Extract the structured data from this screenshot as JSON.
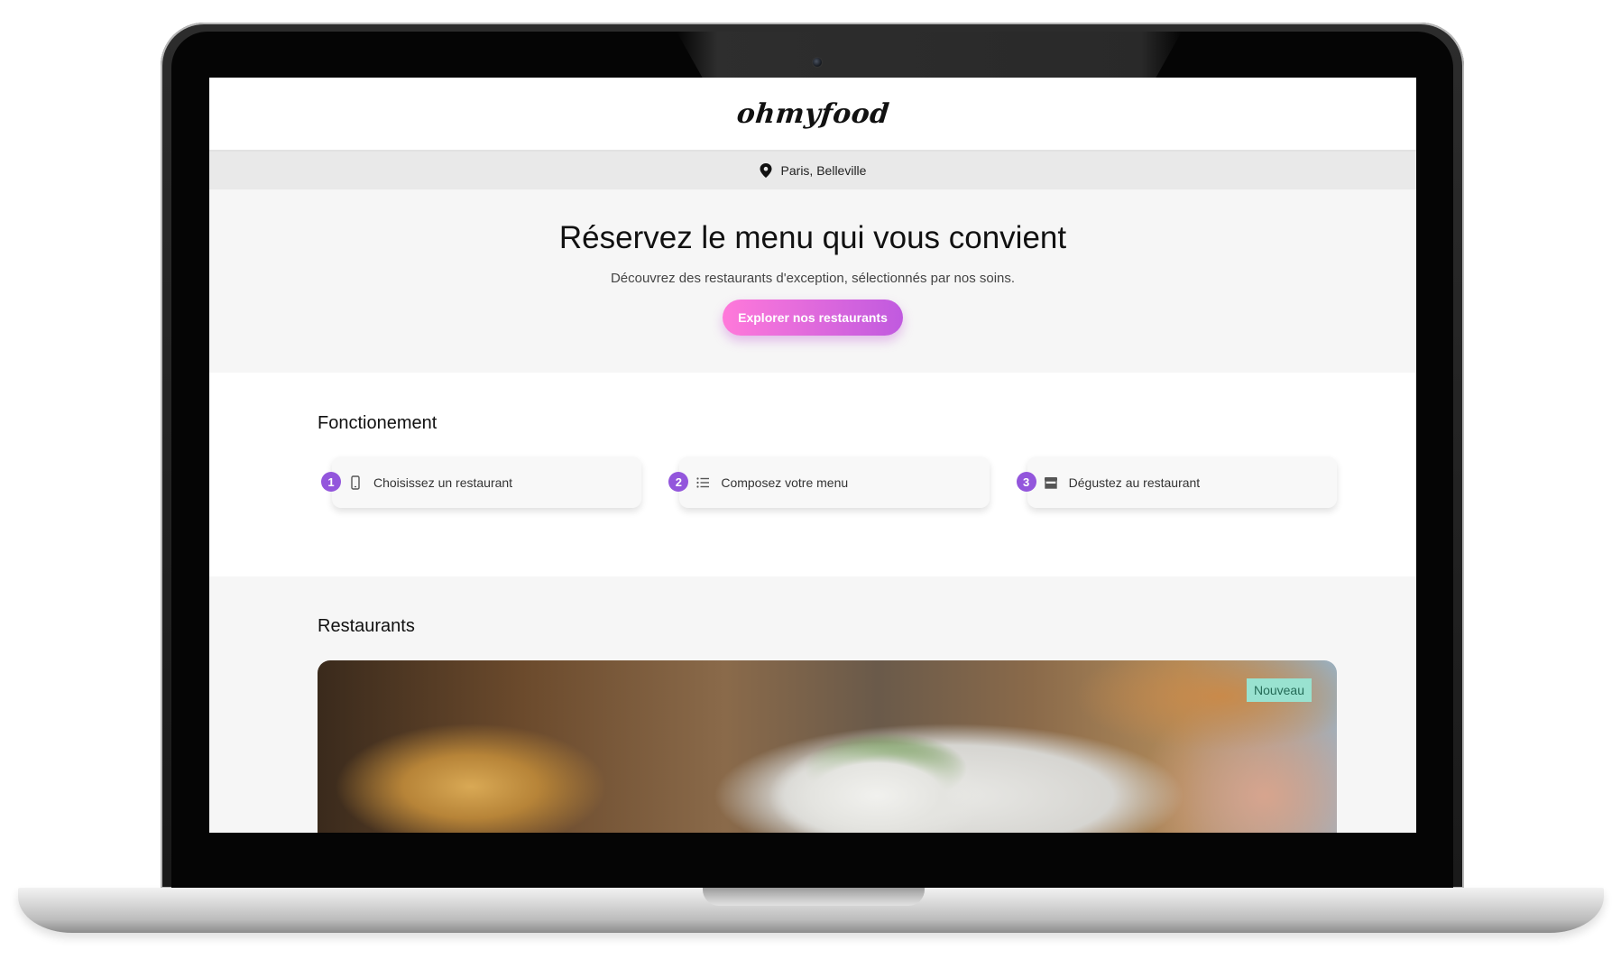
{
  "header": {
    "logo": "ohmyfood"
  },
  "location": {
    "icon": "map-pin-icon",
    "label": "Paris, Belleville"
  },
  "hero": {
    "title": "Réservez le menu qui vous convient",
    "subtitle": "Découvrez des restaurants d'exception, sélectionnés par nos soins.",
    "cta_label": "Explorer nos restaurants"
  },
  "how": {
    "title": "Fonctionement",
    "steps": [
      {
        "number": "1",
        "icon": "phone-icon",
        "label": "Choisissez un restaurant"
      },
      {
        "number": "2",
        "icon": "list-icon",
        "label": "Composez votre menu"
      },
      {
        "number": "3",
        "icon": "store-icon",
        "label": "Dégustez au restaurant"
      }
    ]
  },
  "restaurants": {
    "title": "Restaurants",
    "first_card": {
      "badge": "Nouveau"
    }
  },
  "colors": {
    "accent_pink": "#ff79da",
    "accent_purple": "#9356dc",
    "badge_bg": "#99e2d0",
    "badge_text": "#246b57"
  }
}
